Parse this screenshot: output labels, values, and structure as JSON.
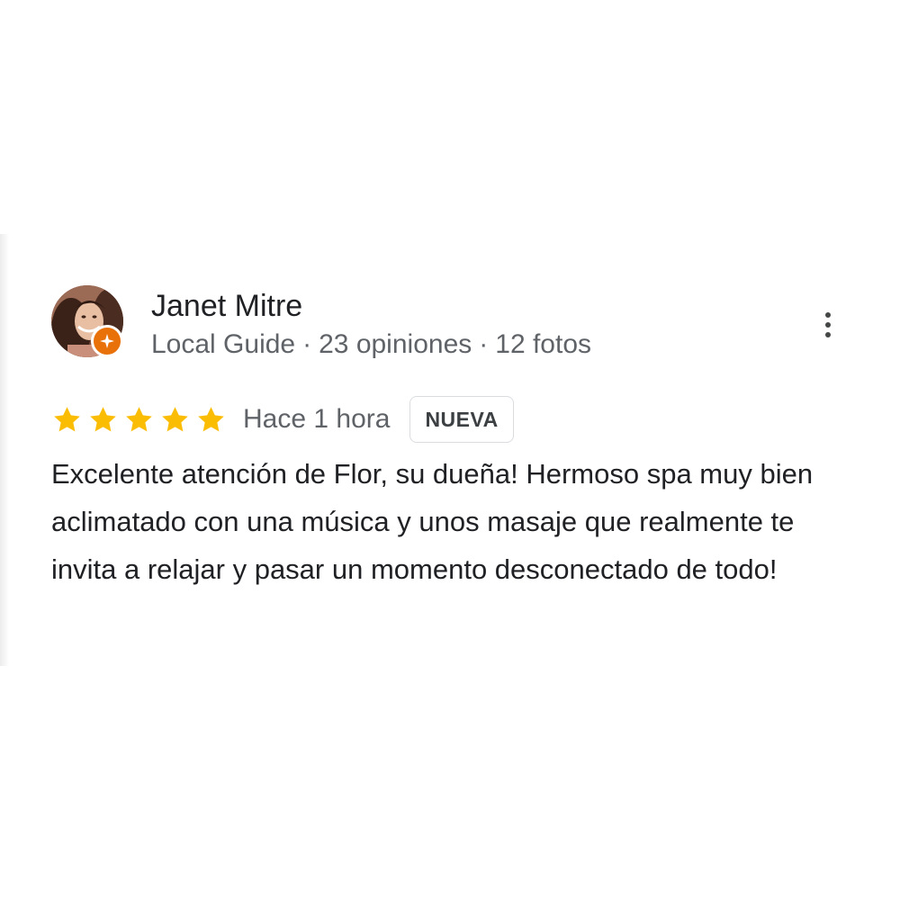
{
  "review": {
    "reviewer": {
      "name": "Janet Mitre",
      "role": "Local Guide",
      "reviews": "23 opiniones",
      "photos": "12 fotos",
      "separator": "·",
      "avatar_icon": "avatar-photo",
      "badge_icon": "local-guide-star-icon",
      "badge_color": "#e8710a"
    },
    "rating": 5,
    "rating_max": 5,
    "star_color": "#fbbc04",
    "time": "Hace 1 hora",
    "badge_label": "NUEVA",
    "text": "Excelente atención de Flor, su dueña! Hermoso spa muy bien aclimatado con una música y unos masaje que realmente te invita a relajar y pasar un momento desconectado de todo!",
    "menu_icon": "more-vert-icon"
  }
}
